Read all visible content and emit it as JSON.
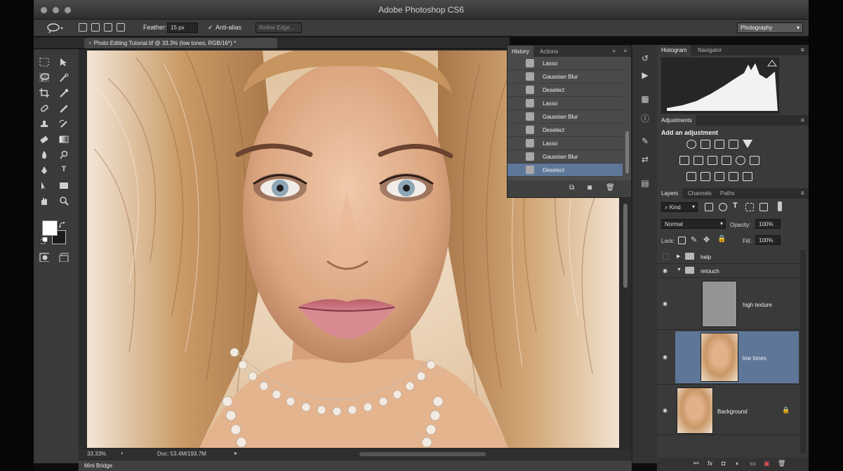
{
  "app": {
    "title": "Adobe Photoshop CS6"
  },
  "options_bar": {
    "feather_label": "Feather:",
    "feather_value": "15 px",
    "antialias_label": "Anti-alias",
    "refine_edge_label": "Refine Edge...",
    "workspace": "Photography"
  },
  "document": {
    "tab_title": "Photo Editing Tutorial.tif @ 33.3% (low tones, RGB/16*) *",
    "zoom": "33.33%",
    "doc_info": "Doc: 53.4M/193.7M"
  },
  "history_panel": {
    "tabs": [
      "History",
      "Actions"
    ],
    "items": [
      {
        "label": "Lasso",
        "icon": "lasso-icon"
      },
      {
        "label": "Gaussian Blur",
        "icon": "filter-icon"
      },
      {
        "label": "Deselect",
        "icon": "deselect-icon"
      },
      {
        "label": "Lasso",
        "icon": "lasso-icon"
      },
      {
        "label": "Gaussian Blur",
        "icon": "filter-icon"
      },
      {
        "label": "Deselect",
        "icon": "deselect-icon"
      },
      {
        "label": "Lasso",
        "icon": "lasso-icon"
      },
      {
        "label": "Gaussian Blur",
        "icon": "filter-icon"
      },
      {
        "label": "Deselect",
        "icon": "deselect-icon",
        "selected": true
      }
    ]
  },
  "histogram_panel": {
    "tabs": [
      "Histogram",
      "Navigator"
    ]
  },
  "adjustments_panel": {
    "title": "Adjustments",
    "add_label": "Add an adjustment"
  },
  "layers_panel": {
    "tabs": [
      "Layers",
      "Channels",
      "Paths"
    ],
    "filter_kind": "Kind",
    "blend_mode": "Normal",
    "opacity_label": "Opacity:",
    "opacity_value": "100%",
    "lock_label": "Lock:",
    "fill_label": "Fill:",
    "fill_value": "100%",
    "layers": [
      {
        "name": "help",
        "type": "group",
        "visible": false
      },
      {
        "name": "retouch",
        "type": "group",
        "visible": true,
        "expanded": true
      },
      {
        "name": "high texture",
        "type": "layer",
        "visible": true
      },
      {
        "name": "low tones",
        "type": "layer",
        "visible": true,
        "selected": true
      },
      {
        "name": "Background",
        "type": "layer",
        "visible": true,
        "locked": true
      }
    ]
  },
  "mini_bridge": {
    "label": "Mini Bridge"
  },
  "colors": {
    "selection_blue": "#5e7799",
    "panel_bg": "#3a3a3a",
    "app_bg": "#2b2b2b"
  }
}
